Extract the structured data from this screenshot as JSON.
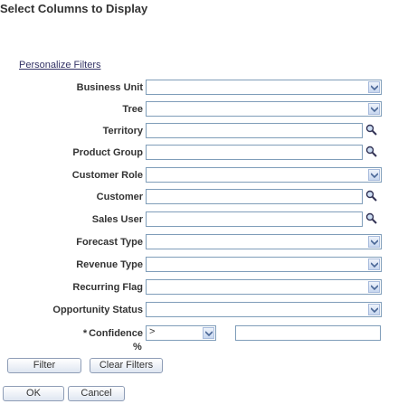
{
  "page": {
    "title": "Select Columns to Display",
    "personalize_link": "Personalize Filters"
  },
  "filters": {
    "business_unit": "Business Unit",
    "tree": "Tree",
    "territory": "Territory",
    "product_group": "Product Group",
    "customer_role": "Customer Role",
    "customer": "Customer",
    "sales_user": "Sales User",
    "forecast_type": "Forecast Type",
    "revenue_type": "Revenue Type",
    "recurring_flag": "Recurring Flag",
    "opportunity_status": "Opportunity Status",
    "confidence": {
      "required_marker": "*",
      "label": "Confidence",
      "operator": ">",
      "value": "",
      "unit": "%"
    }
  },
  "buttons": {
    "filter": "Filter",
    "clear_filters": "Clear Filters",
    "ok": "OK",
    "cancel": "Cancel"
  },
  "colors": {
    "field_border": "#7f9db9",
    "link": "#333366",
    "button_gradient_bottom": "#dfe6f1"
  }
}
